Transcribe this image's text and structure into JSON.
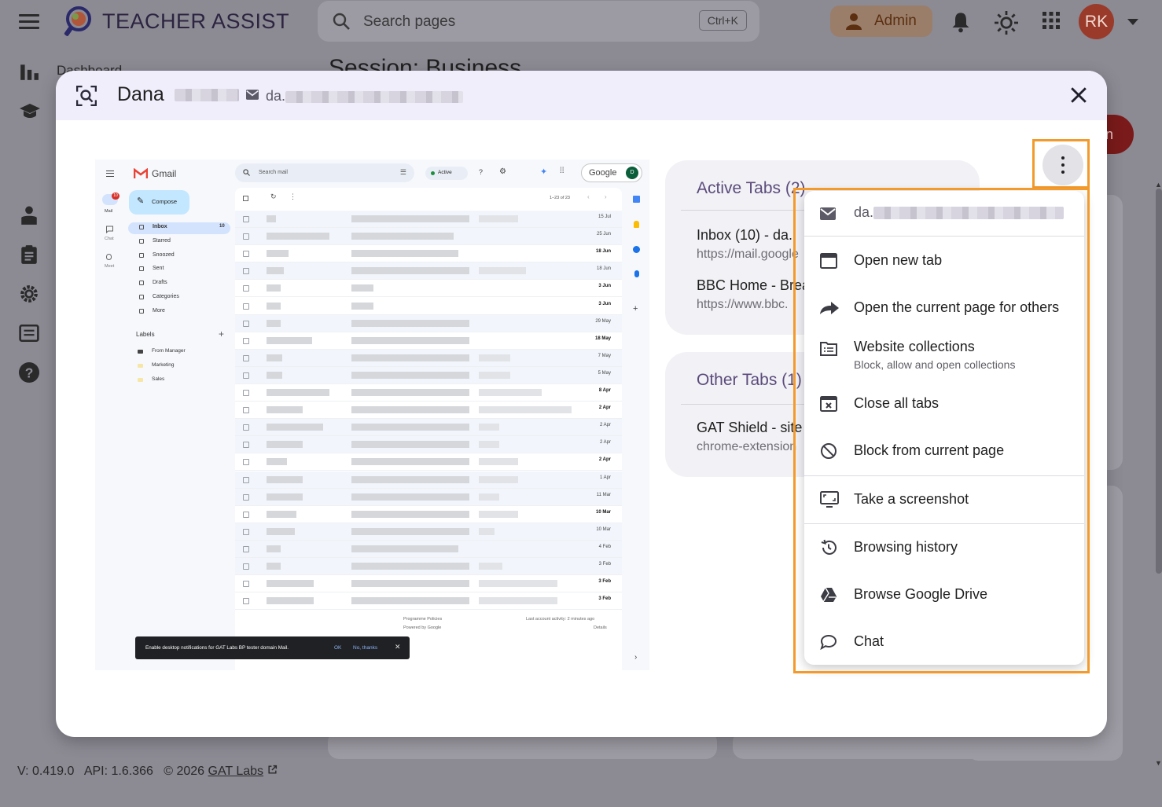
{
  "app": {
    "title": "TEACHER ASSIST",
    "search_placeholder": "Search pages",
    "search_shortcut": "Ctrl+K",
    "role_label": "Admin",
    "user_initials": "RK"
  },
  "background": {
    "breadcrumb": "Dashboard",
    "heading": "Session: Business",
    "side_button_fragment": "on"
  },
  "footer": {
    "version": "V: 0.419.0",
    "api": "API: 1.6.366",
    "copyright": "© 2026",
    "link": "GAT Labs"
  },
  "modal": {
    "student_first_name": "Dana",
    "email_prefix": "da."
  },
  "gmail": {
    "brand": "Gmail",
    "search": "Search mail",
    "status": "Active",
    "compose": "Compose",
    "rail": [
      "Mail",
      "Chat",
      "Meet"
    ],
    "rail_badge": "10",
    "folders": [
      {
        "label": "Inbox",
        "count": "10"
      },
      {
        "label": "Starred",
        "count": ""
      },
      {
        "label": "Snoozed",
        "count": ""
      },
      {
        "label": "Sent",
        "count": ""
      },
      {
        "label": "Drafts",
        "count": ""
      },
      {
        "label": "Categories",
        "count": ""
      },
      {
        "label": "More",
        "count": ""
      }
    ],
    "labels_title": "Labels",
    "labels": [
      "From Manager",
      "Marketing",
      "Sales"
    ],
    "pager": "1–23 of 23",
    "google_btn": "Google",
    "google_avatar": "D",
    "dates": [
      "15 Jul",
      "25 Jun",
      "18 Jun",
      "18 Jun",
      "3 Jun",
      "3 Jun",
      "29 May",
      "18 May",
      "7 May",
      "5 May",
      "8 Apr",
      "2 Apr",
      "2 Apr",
      "2 Apr",
      "2 Apr",
      "1 Apr",
      "11 Mar",
      "10 Mar",
      "10 Mar",
      "4 Feb",
      "3 Feb",
      "3 Feb",
      "3 Feb"
    ],
    "bold_rows": [
      2,
      4,
      5,
      7,
      10,
      11,
      14,
      17,
      21,
      22
    ],
    "footer_left1": "Programme Policies",
    "footer_left2": "Powered by Google",
    "footer_right1": "Last account activity: 2 minutes ago",
    "footer_right2": "Details",
    "toast_text": "Enable desktop notifications for GAT Labs BP tester domain Mail.",
    "toast_ok": "OK",
    "toast_no": "No, thanks"
  },
  "active_tabs": {
    "title": "Active Tabs (2)",
    "items": [
      {
        "name": "Inbox (10) - da.",
        "url": "https://mail.google"
      },
      {
        "name": "BBC Home - Brea",
        "url": "https://www.bbc."
      }
    ]
  },
  "other_tabs": {
    "title": "Other Tabs (1)",
    "items": [
      {
        "name": "GAT Shield - site",
        "url": "chrome-extension"
      }
    ]
  },
  "menu": {
    "email": "da.",
    "items": [
      {
        "label": "Open new tab",
        "sub": ""
      },
      {
        "label": "Open the current page for others",
        "sub": ""
      },
      {
        "label": "Website collections",
        "sub": "Block, allow and open collections"
      },
      {
        "label": "Close all tabs",
        "sub": ""
      },
      {
        "label": "Block from current page",
        "sub": ""
      },
      {
        "label": "Take a screenshot",
        "sub": ""
      },
      {
        "label": "Browsing history",
        "sub": ""
      },
      {
        "label": "Browse Google Drive",
        "sub": ""
      },
      {
        "label": "Chat",
        "sub": ""
      }
    ]
  },
  "colors": {
    "overlay": "#8c8a93",
    "highlight": "#f39a2c",
    "modal_header": "#f0eefb",
    "card_title": "#5a4b7c"
  }
}
